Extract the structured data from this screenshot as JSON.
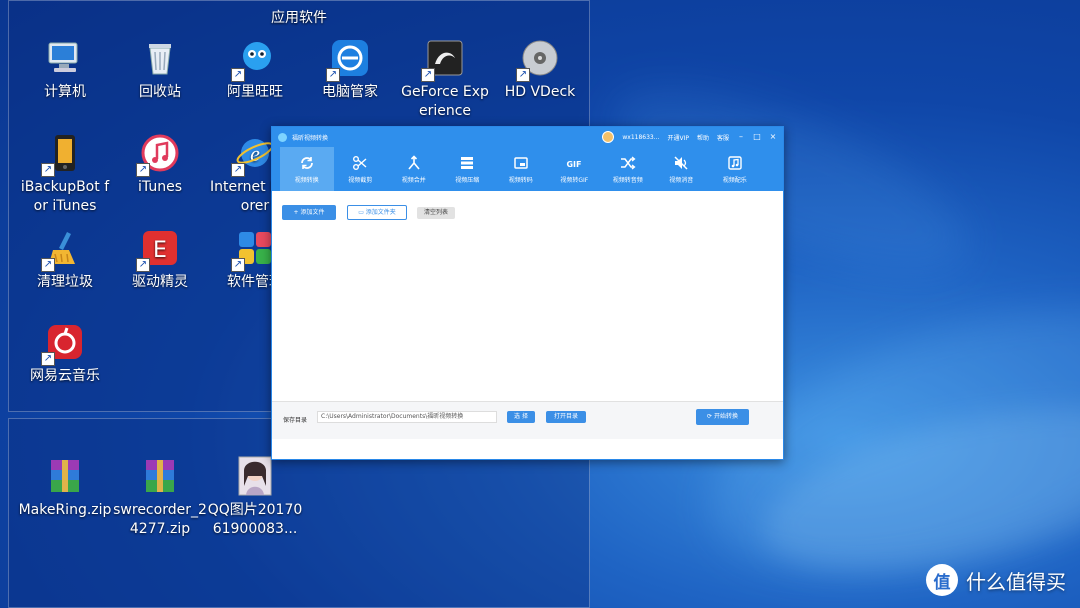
{
  "desktop": {
    "fence_title": "应用软件",
    "icons": [
      {
        "label": "计算机",
        "icon": "computer-icon"
      },
      {
        "label": "回收站",
        "icon": "recycle-bin-icon"
      },
      {
        "label": "阿里旺旺",
        "icon": "aliwangwang-icon"
      },
      {
        "label": "电脑管家",
        "icon": "pc-manager-icon"
      },
      {
        "label": "GeForce Experience",
        "icon": "geforce-icon"
      },
      {
        "label": "HD VDeck",
        "icon": "hd-vdeck-icon"
      },
      {
        "label": "iBackupBot for iTunes",
        "icon": "ibackupbot-icon"
      },
      {
        "label": "iTunes",
        "icon": "itunes-icon"
      },
      {
        "label": "Internet Explorer",
        "icon": "internet-explorer-icon"
      },
      {
        "label": "清理垃圾",
        "icon": "clean-junk-icon"
      },
      {
        "label": "驱动精灵",
        "icon": "driver-genius-icon"
      },
      {
        "label": "软件管理",
        "icon": "software-manager-icon"
      },
      {
        "label": "网易云音乐",
        "icon": "netease-music-icon"
      }
    ],
    "files": [
      {
        "label": "MakeRing.zip",
        "icon": "winrar-archive-icon"
      },
      {
        "label": "swrecorder_24277.zip",
        "icon": "winrar-archive-icon"
      },
      {
        "label": "QQ图片2017061900083...",
        "icon": "image-file-icon"
      }
    ]
  },
  "app": {
    "title": "福昕视频转换",
    "user": "wx118633...",
    "vip": "开通VIP",
    "help": "帮助",
    "service": "客服",
    "minimize": "–",
    "maximize": "□",
    "close": "×",
    "tools": [
      {
        "label": "视频转换",
        "icon": "convert-icon"
      },
      {
        "label": "视频截剪",
        "icon": "scissors-icon"
      },
      {
        "label": "视频合并",
        "icon": "merge-icon"
      },
      {
        "label": "视频压缩",
        "icon": "compress-icon"
      },
      {
        "label": "视频转码",
        "icon": "transcode-icon"
      },
      {
        "label": "视频转GIF",
        "icon": "gif-icon"
      },
      {
        "label": "视频转音频",
        "icon": "shuffle-icon"
      },
      {
        "label": "视频消音",
        "icon": "mute-icon"
      },
      {
        "label": "视频配乐",
        "icon": "music-icon"
      }
    ],
    "gif_text": "GIF",
    "add_file": "添加文件",
    "add_folder": "添加文件夹",
    "clear_list": "清空列表",
    "save_label": "保存目录",
    "save_path": "C:\\Users\\Administrator\\Documents\\福昕视频转换",
    "choose": "选 择",
    "open_dir": "打开目录",
    "start": "开始转换"
  },
  "watermark": {
    "text": "什么值得买",
    "logo": "值"
  }
}
